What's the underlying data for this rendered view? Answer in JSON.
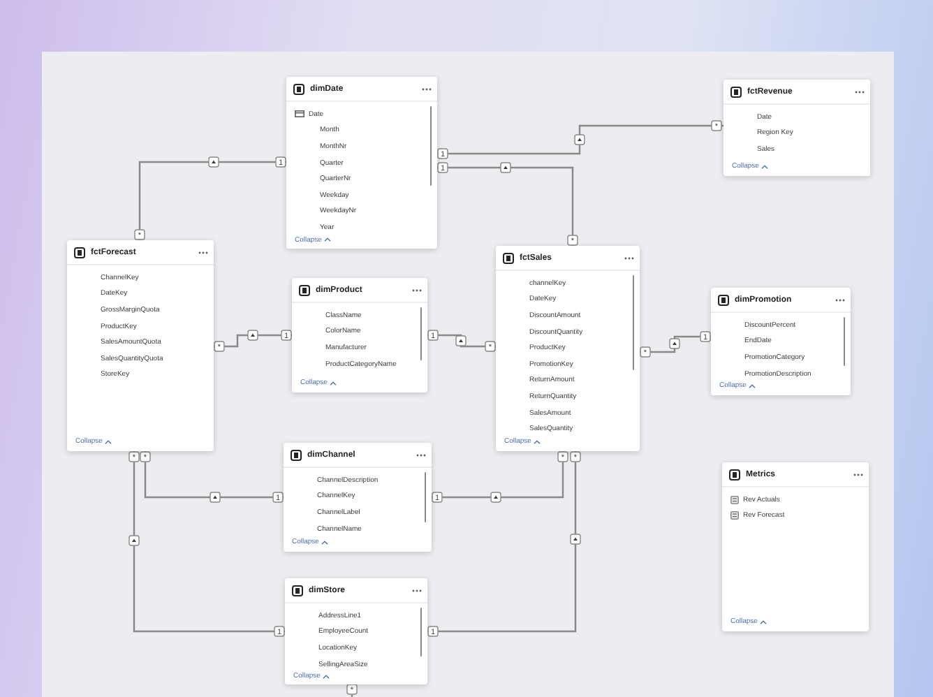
{
  "tables": [
    {
      "title": "dimDate",
      "scrollbar": true,
      "collapse_label": "Collapse",
      "fields": [
        {
          "name": "Date",
          "kind": "date_hierarchy"
        },
        {
          "name": "Month",
          "kind": "column"
        },
        {
          "name": "MonthNr",
          "kind": "column"
        },
        {
          "name": "Quarter",
          "kind": "column"
        },
        {
          "name": "QuarterNr",
          "kind": "column"
        },
        {
          "name": "Weekday",
          "kind": "column"
        },
        {
          "name": "WeekdayNr",
          "kind": "column"
        },
        {
          "name": "Year",
          "kind": "column"
        }
      ]
    },
    {
      "title": "fctRevenue",
      "scrollbar": false,
      "collapse_label": "Collapse",
      "fields": [
        {
          "name": "Date",
          "kind": "column"
        },
        {
          "name": "Region Key",
          "kind": "column"
        },
        {
          "name": "Sales",
          "kind": "column"
        }
      ]
    },
    {
      "title": "fctForecast",
      "scrollbar": false,
      "collapse_label": "Collapse",
      "fields": [
        {
          "name": "ChannelKey",
          "kind": "column"
        },
        {
          "name": "DateKey",
          "kind": "column"
        },
        {
          "name": "GrossMarginQuota",
          "kind": "column"
        },
        {
          "name": "ProductKey",
          "kind": "column"
        },
        {
          "name": "SalesAmountQuota",
          "kind": "column"
        },
        {
          "name": "SalesQuantityQuota",
          "kind": "column"
        },
        {
          "name": "StoreKey",
          "kind": "column"
        }
      ]
    },
    {
      "title": "fctSales",
      "scrollbar": true,
      "collapse_label": "Collapse",
      "fields": [
        {
          "name": "channelKey",
          "kind": "column"
        },
        {
          "name": "DateKey",
          "kind": "column"
        },
        {
          "name": "DiscountAmount",
          "kind": "column"
        },
        {
          "name": "DiscountQuantity",
          "kind": "column"
        },
        {
          "name": "ProductKey",
          "kind": "column"
        },
        {
          "name": "PromotionKey",
          "kind": "column"
        },
        {
          "name": "ReturnAmount",
          "kind": "column"
        },
        {
          "name": "ReturnQuantity",
          "kind": "column"
        },
        {
          "name": "SalesAmount",
          "kind": "column"
        },
        {
          "name": "SalesQuantity",
          "kind": "column"
        }
      ]
    },
    {
      "title": "dimProduct",
      "scrollbar": true,
      "collapse_label": "Collapse",
      "fields": [
        {
          "name": "ClassName",
          "kind": "column"
        },
        {
          "name": "ColorName",
          "kind": "column"
        },
        {
          "name": "Manufacturer",
          "kind": "column"
        },
        {
          "name": "ProductCategoryName",
          "kind": "column"
        }
      ]
    },
    {
      "title": "dimPromotion",
      "scrollbar": true,
      "collapse_label": "Collapse",
      "fields": [
        {
          "name": "DiscountPercent",
          "kind": "column"
        },
        {
          "name": "EndDate",
          "kind": "column"
        },
        {
          "name": "PromotionCategory",
          "kind": "column"
        },
        {
          "name": "PromotionDescription",
          "kind": "column"
        }
      ]
    },
    {
      "title": "dimChannel",
      "scrollbar": true,
      "collapse_label": "Collapse",
      "fields": [
        {
          "name": "ChannelDescription",
          "kind": "column"
        },
        {
          "name": "ChannelKey",
          "kind": "column"
        },
        {
          "name": "ChannelLabel",
          "kind": "column"
        },
        {
          "name": "ChannelName",
          "kind": "column"
        }
      ]
    },
    {
      "title": "Metrics",
      "scrollbar": false,
      "collapse_label": "Collapse",
      "fields": [
        {
          "name": "Rev Actuals",
          "kind": "measure"
        },
        {
          "name": "Rev Forecast",
          "kind": "measure"
        }
      ]
    },
    {
      "title": "dimStore",
      "scrollbar": true,
      "collapse_label": "Collapse",
      "fields": [
        {
          "name": "AddressLine1",
          "kind": "column"
        },
        {
          "name": "EmployeeCount",
          "kind": "column"
        },
        {
          "name": "LocationKey",
          "kind": "column"
        },
        {
          "name": "SellingAreaSize",
          "kind": "column"
        }
      ]
    }
  ],
  "cardinality_markers": [
    "*",
    "1",
    "1",
    "1",
    "*",
    "*",
    "1",
    "1",
    "1",
    "*",
    "*",
    "*",
    "*",
    "*",
    "*",
    "*",
    "1",
    "1",
    "1",
    "1",
    "*"
  ]
}
